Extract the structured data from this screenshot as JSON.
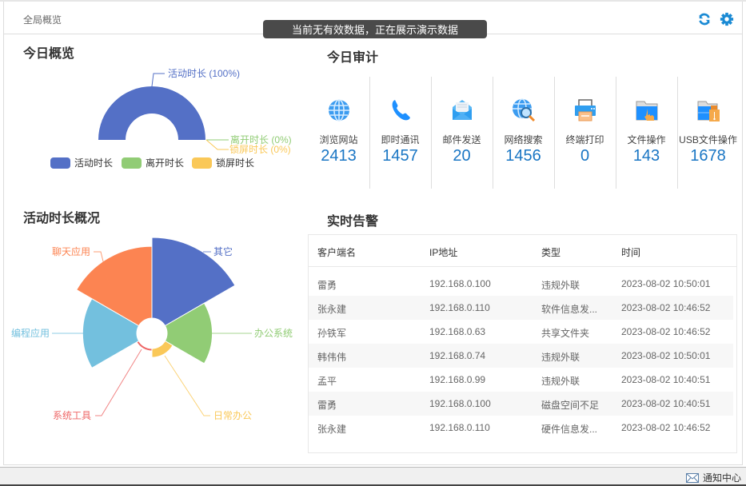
{
  "header": {
    "title": "全局概览",
    "refresh_icon": "refresh-icon",
    "settings_icon": "gear-icon",
    "accent": "#1a8ad4"
  },
  "toast": "当前无有效数据，正在展示演示数据",
  "overview": {
    "title": "今日概览",
    "labels": [
      "活动时长 (100%)",
      "离开时长 (0%)",
      "锁屏时长 (0%)"
    ]
  },
  "audit": {
    "title": "今日审计",
    "items": [
      {
        "label": "浏览网站",
        "value": "2413",
        "icon": "globe-icon"
      },
      {
        "label": "即时通讯",
        "value": "1457",
        "icon": "phone-icon"
      },
      {
        "label": "邮件发送",
        "value": "20",
        "icon": "mail-icon"
      },
      {
        "label": "网络搜索",
        "value": "1456",
        "icon": "web-search-icon"
      },
      {
        "label": "终端打印",
        "value": "0",
        "icon": "printer-icon"
      },
      {
        "label": "文件操作",
        "value": "143",
        "icon": "folder-touch-icon"
      },
      {
        "label": "USB文件操作",
        "value": "1678",
        "icon": "usb-folder-icon"
      }
    ]
  },
  "activity": {
    "title": "活动时长概况"
  },
  "alerts": {
    "title": "实时告警",
    "columns": [
      "客户端名",
      "IP地址",
      "类型",
      "时间"
    ],
    "rows": [
      [
        "雷勇",
        "192.168.0.100",
        "违规外联",
        "2023-08-02 10:50:01"
      ],
      [
        "张永建",
        "192.168.0.110",
        "软件信息发...",
        "2023-08-02 10:46:52"
      ],
      [
        "孙铁军",
        "192.168.0.63",
        "共享文件夹",
        "2023-08-02 10:46:52"
      ],
      [
        "韩伟伟",
        "192.168.0.74",
        "违规外联",
        "2023-08-02 10:50:01"
      ],
      [
        "孟平",
        "192.168.0.99",
        "违规外联",
        "2023-08-02 10:40:51"
      ],
      [
        "雷勇",
        "192.168.0.100",
        "磁盘空间不足",
        "2023-08-02 10:40:51"
      ],
      [
        "张永建",
        "192.168.0.110",
        "硬件信息发...",
        "2023-08-02 10:46:52"
      ]
    ]
  },
  "statusbar": {
    "notice_label": "通知中心"
  },
  "chart_data": [
    {
      "type": "pie",
      "variant": "half-donut",
      "title": "今日概览",
      "categories": [
        "活动时长",
        "离开时长",
        "锁屏时长"
      ],
      "values": [
        100,
        0,
        0
      ],
      "percent_labels": [
        "活动时长 (100%)",
        "离开时长 (0%)",
        "锁屏时长 (0%)"
      ],
      "colors": [
        "#5470c6",
        "#91cc75",
        "#fac858"
      ],
      "legend": [
        "活动时长",
        "离开时长",
        "锁屏时长"
      ],
      "legend_position": "bottom"
    },
    {
      "type": "pie",
      "variant": "nightingale-rose",
      "title": "活动时长概况",
      "categories": [
        "其它",
        "办公系统",
        "日常办公",
        "系统工具",
        "编程应用",
        "聊天应用"
      ],
      "values": [
        100,
        56,
        11,
        3,
        67,
        89
      ],
      "colors": [
        "#5470c6",
        "#91cc75",
        "#fac858",
        "#ee6666",
        "#73c0de",
        "#fc8452"
      ]
    }
  ]
}
